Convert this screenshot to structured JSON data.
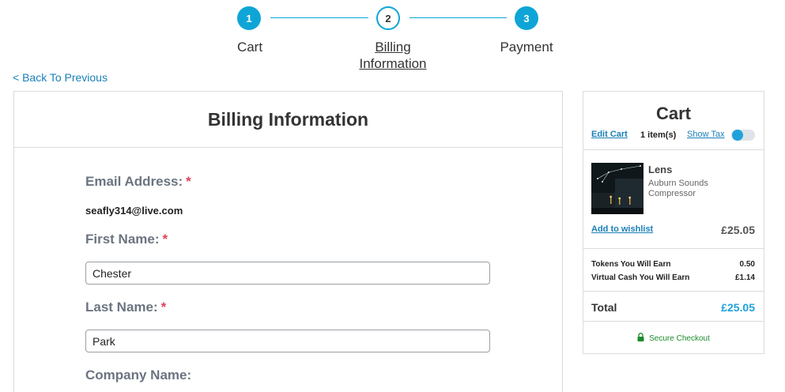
{
  "stepper": {
    "steps": [
      {
        "number": "1",
        "label": "Cart",
        "state": "done"
      },
      {
        "number": "2",
        "label_line1": "Billing",
        "label_line2": "Information",
        "state": "current"
      },
      {
        "number": "3",
        "label": "Payment",
        "state": "upcoming"
      }
    ],
    "accent_color": "#0ea5d6"
  },
  "nav": {
    "back_label": "< Back To Previous"
  },
  "billing": {
    "title": "Billing Information",
    "email": {
      "label": "Email Address:",
      "required": "*",
      "value": "seafly314@live.com"
    },
    "first_name": {
      "label": "First Name:",
      "required": "*",
      "value": "Chester"
    },
    "last_name": {
      "label": "Last Name:",
      "required": "*",
      "value": "Park"
    },
    "company": {
      "label": "Company Name:"
    }
  },
  "cart": {
    "title": "Cart",
    "edit_label": "Edit Cart",
    "item_count": "1 item(s)",
    "show_tax_label": "Show Tax",
    "item": {
      "name": "Lens",
      "subtitle": "Auburn Sounds Compressor",
      "wishlist_label": "Add to wishlist",
      "price": "£25.05"
    },
    "earnings": [
      {
        "label": "Tokens You Will Earn",
        "value": "0.50"
      },
      {
        "label": "Virtual Cash You Will Earn",
        "value": "£1.14"
      }
    ],
    "total_label": "Total",
    "total_value": "£25.05",
    "secure_label": "Secure Checkout"
  }
}
